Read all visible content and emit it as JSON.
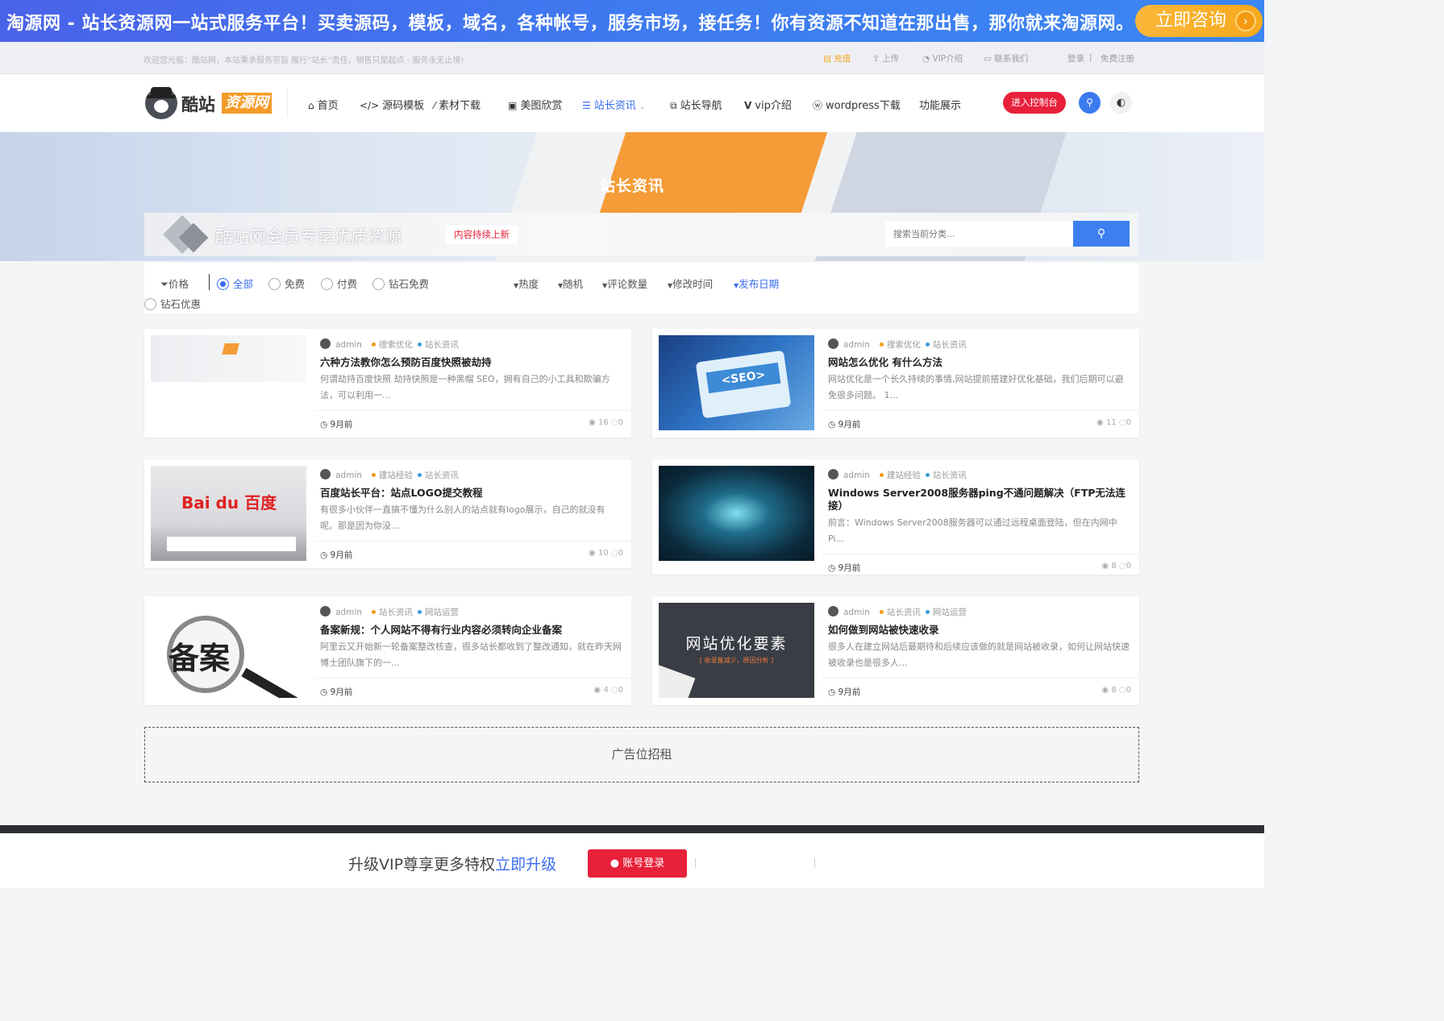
{
  "banner": {
    "text": "淘源网 - 站长资源网一站式服务平台！买卖源码，模板，域名，各种帐号，服务市场，接任务！你有资源不知道在那出售，那你就来淘源网。",
    "button": "立即咨询"
  },
  "infobar": {
    "welcome": "欢迎您光临：酷站网，本站秉承服务宗旨 履行“站长”责任，销售只是起点 - 服务永无止境!",
    "links": [
      "充值",
      "上传",
      "VIP介绍",
      "联系我们"
    ],
    "login": "登录",
    "sep": "|",
    "register": "免费注册"
  },
  "logo": {
    "name": "酷站",
    "badge": "资源网"
  },
  "nav": [
    {
      "label": "首页",
      "icon": "home-icon"
    },
    {
      "label": "源码模板",
      "icon": "code-icon"
    },
    {
      "label": "素材下载",
      "icon": "magic-wand-icon"
    },
    {
      "label": "美图欣赏",
      "icon": "image-icon"
    },
    {
      "label": "站长资讯",
      "icon": "list-icon",
      "active": true
    },
    {
      "label": "站长导航",
      "icon": "copy-icon"
    },
    {
      "label": "vip介绍",
      "icon": "v-icon"
    },
    {
      "label": "wordpress下载",
      "icon": "wordpress-icon"
    },
    {
      "label": "功能展示",
      "icon": ""
    }
  ],
  "header": {
    "control": "进入控制台"
  },
  "hero": {
    "title": "站长资讯"
  },
  "promo": {
    "text": "酷站网会员专享优质资源",
    "tag": "内容持续上新",
    "search_placeholder": "搜索当前分类..."
  },
  "filter": {
    "price_label": "价格",
    "options": [
      "全部",
      "免费",
      "付费",
      "钻石免费",
      "钻石优惠"
    ],
    "sorts": [
      "热度",
      "随机",
      "评论数量",
      "修改时间",
      "发布日期"
    ]
  },
  "posts": [
    {
      "author": "admin",
      "cats": [
        "搜索优化",
        "站长资讯"
      ],
      "title": "六种方法教你怎么预防百度快照被劫持",
      "desc": "何谓劫持百度快照 劫持快照是一种黑帽 SEO，拥有自己的小工具和欺骗方法，可以利用一...",
      "time": "9月前",
      "views": "16",
      "comments": "0"
    },
    {
      "author": "admin",
      "cats": [
        "搜索优化",
        "站长资讯"
      ],
      "title": "网站怎么优化 有什么方法",
      "desc": "网站优化是一个长久持续的事情,网站提前搭建好优化基础，我们后期可以避免很多问题。 1...",
      "time": "9月前",
      "views": "11",
      "comments": "0",
      "thumb_text": "<SEO>"
    },
    {
      "author": "admin",
      "cats": [
        "建站经验",
        "站长资讯"
      ],
      "title": "百度站长平台：站点LOGO提交教程",
      "desc": "有很多小伙伴一直搞不懂为什么别人的站点就有logo展示，自己的就没有呢。那是因为你没...",
      "time": "9月前",
      "views": "10",
      "comments": "0",
      "thumb_text": "Bai du 百度"
    },
    {
      "author": "admin",
      "cats": [
        "建站经验",
        "站长资讯"
      ],
      "title": "Windows Server2008服务器ping不通问题解决（FTP无法连接）",
      "desc": "前言：Windows Server2008服务器可以通过远程桌面登陆，但在内网中Pi...",
      "time": "9月前",
      "views": "8",
      "comments": "0"
    },
    {
      "author": "admin",
      "cats": [
        "站长资讯",
        "网站运营"
      ],
      "title": "备案新规：个人网站不得有行业内容必须转向企业备案",
      "desc": "阿里云又开始新一轮备案整改核查，很多站长都收到了整改通知，就在昨天网博士团队旗下的一...",
      "time": "9月前",
      "views": "4",
      "comments": "0",
      "thumb_text": "备案"
    },
    {
      "author": "admin",
      "cats": [
        "站长资讯",
        "网站运营"
      ],
      "title": "如何做到网站被快速收录",
      "desc": "很多人在建立网站后最期待和后续应该做的就是网站被收录，如何让网站快速被收录也是很多人...",
      "time": "9月前",
      "views": "8",
      "comments": "0",
      "thumb_text": "网站优化要素",
      "thumb_sub": "[ 收录量减少，原因分析 ]"
    }
  ],
  "ad": {
    "text": "广告位招租"
  },
  "bottom": {
    "text": "升级VIP尊享更多特权",
    "link": "立即升级",
    "login": "账号登录"
  }
}
